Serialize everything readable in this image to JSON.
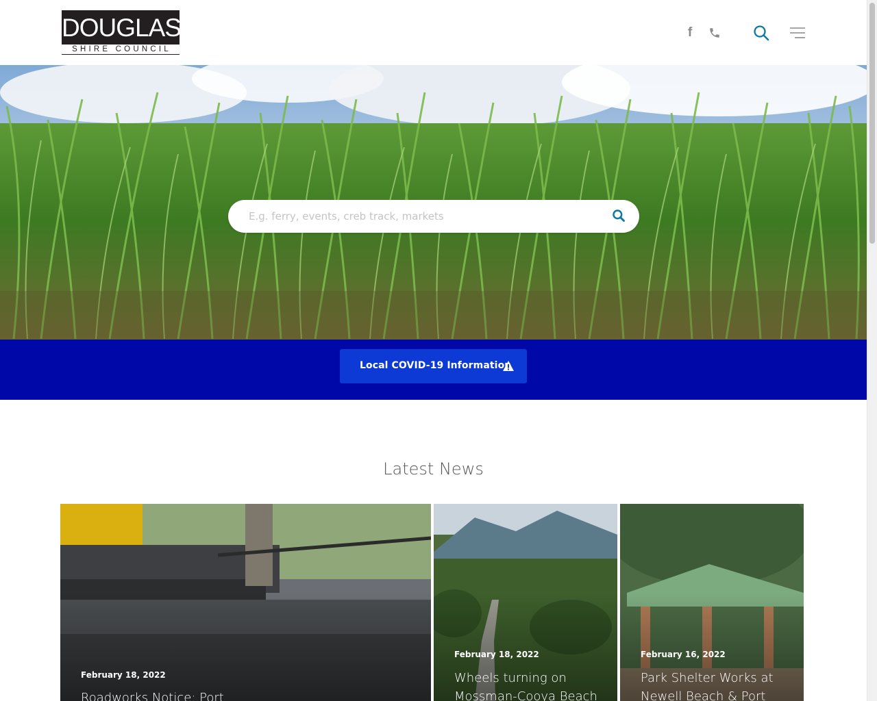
{
  "header": {
    "logo_top": "DOUGLAS",
    "logo_bottom": "SHIRE COUNCIL",
    "icons": [
      "facebook-icon",
      "phone-icon",
      "search-icon",
      "menu-icon"
    ],
    "facebook_glyph": "f"
  },
  "hero": {
    "search_placeholder": "E.g. ferry, events, creb track, markets"
  },
  "covid": {
    "label": "Local COVID-19 Information",
    "band_color": "#0009a7",
    "button_color": "#0d3ad4"
  },
  "news": {
    "heading": "Latest News",
    "items": [
      {
        "date": "February 18, 2022",
        "title": "Roadworks Notice: Port"
      },
      {
        "date": "February 18, 2022",
        "title": "Wheels turning on Mossman-Cooya Beach"
      },
      {
        "date": "February 16, 2022",
        "title": "Park Shelter Works at Newell Beach & Port"
      }
    ]
  },
  "colors": {
    "accent": "#0e7aa0",
    "icon_grey": "#8a8a8a"
  }
}
